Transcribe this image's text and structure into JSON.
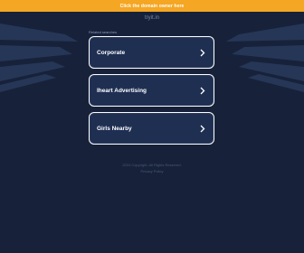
{
  "banner": {
    "text": "Click the domain owner here"
  },
  "site": {
    "domain": "tryit.in"
  },
  "related": {
    "heading": "Related searches"
  },
  "links": [
    {
      "label": "Corporate"
    },
    {
      "label": "Iheart Advertising"
    },
    {
      "label": "Girls Nearby"
    }
  ],
  "footer": {
    "line1": "2024 Copyright. All Rights Reserved.",
    "line2": "Privacy Policy"
  },
  "colors": {
    "background": "#17223a",
    "banner": "#f5a623",
    "card": "#1e2f52",
    "card_border": "#ffffff"
  }
}
